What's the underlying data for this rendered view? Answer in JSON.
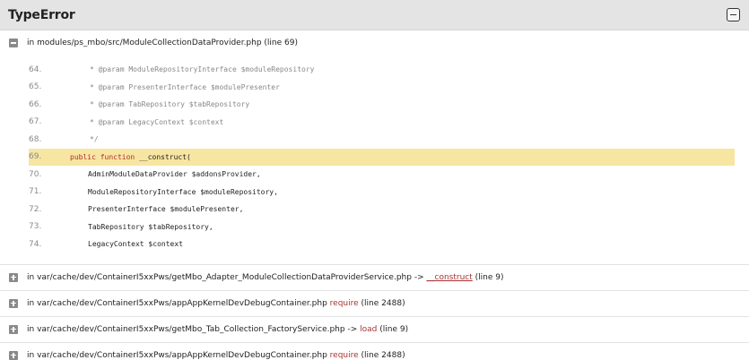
{
  "header": {
    "title": "TypeError"
  },
  "traces": [
    {
      "location": "in modules/ps_mbo/src/ModuleCollectionDataProvider.php (line 69)",
      "code_lines": [
        {
          "num": "64.",
          "text": "* @param ModuleRepositoryInterface $moduleRepository",
          "comment": true
        },
        {
          "num": "65.",
          "text": "* @param PresenterInterface $modulePresenter",
          "comment": true
        },
        {
          "num": "66.",
          "text": "* @param TabRepository $tabRepository",
          "comment": true
        },
        {
          "num": "67.",
          "text": "* @param LegacyContext $context",
          "comment": true
        },
        {
          "num": "68.",
          "text": "*/",
          "comment": true
        },
        {
          "num": "69.",
          "text_kw": "public function",
          "text_rest": " __construct(",
          "highlight": true
        },
        {
          "num": "70.",
          "text": "AdminModuleDataProvider $addonsProvider,"
        },
        {
          "num": "71.",
          "text": "ModuleRepositoryInterface $moduleRepository,"
        },
        {
          "num": "72.",
          "text": "PresenterInterface $modulePresenter,"
        },
        {
          "num": "73.",
          "text": "TabRepository $tabRepository,"
        },
        {
          "num": "74.",
          "text": "LegacyContext $context"
        }
      ]
    },
    {
      "prefix": "in var/cache/dev/ContainerI5xxPws/getMbo_Adapter_ModuleCollectionDataProviderService.php ->",
      "fn": "__construct",
      "suffix": "(line 9)"
    },
    {
      "prefix": "in var/cache/dev/ContainerI5xxPws/appAppKernelDevDebugContainer.php",
      "fn": "require",
      "suffix": "(line 2488)"
    },
    {
      "prefix": "in var/cache/dev/ContainerI5xxPws/getMbo_Tab_Collection_FactoryService.php ->",
      "fn": "load",
      "suffix": "(line 9)"
    },
    {
      "prefix": "in var/cache/dev/ContainerI5xxPws/appAppKernelDevDebugContainer.php",
      "fn": "require",
      "suffix": "(line 2488)"
    }
  ]
}
